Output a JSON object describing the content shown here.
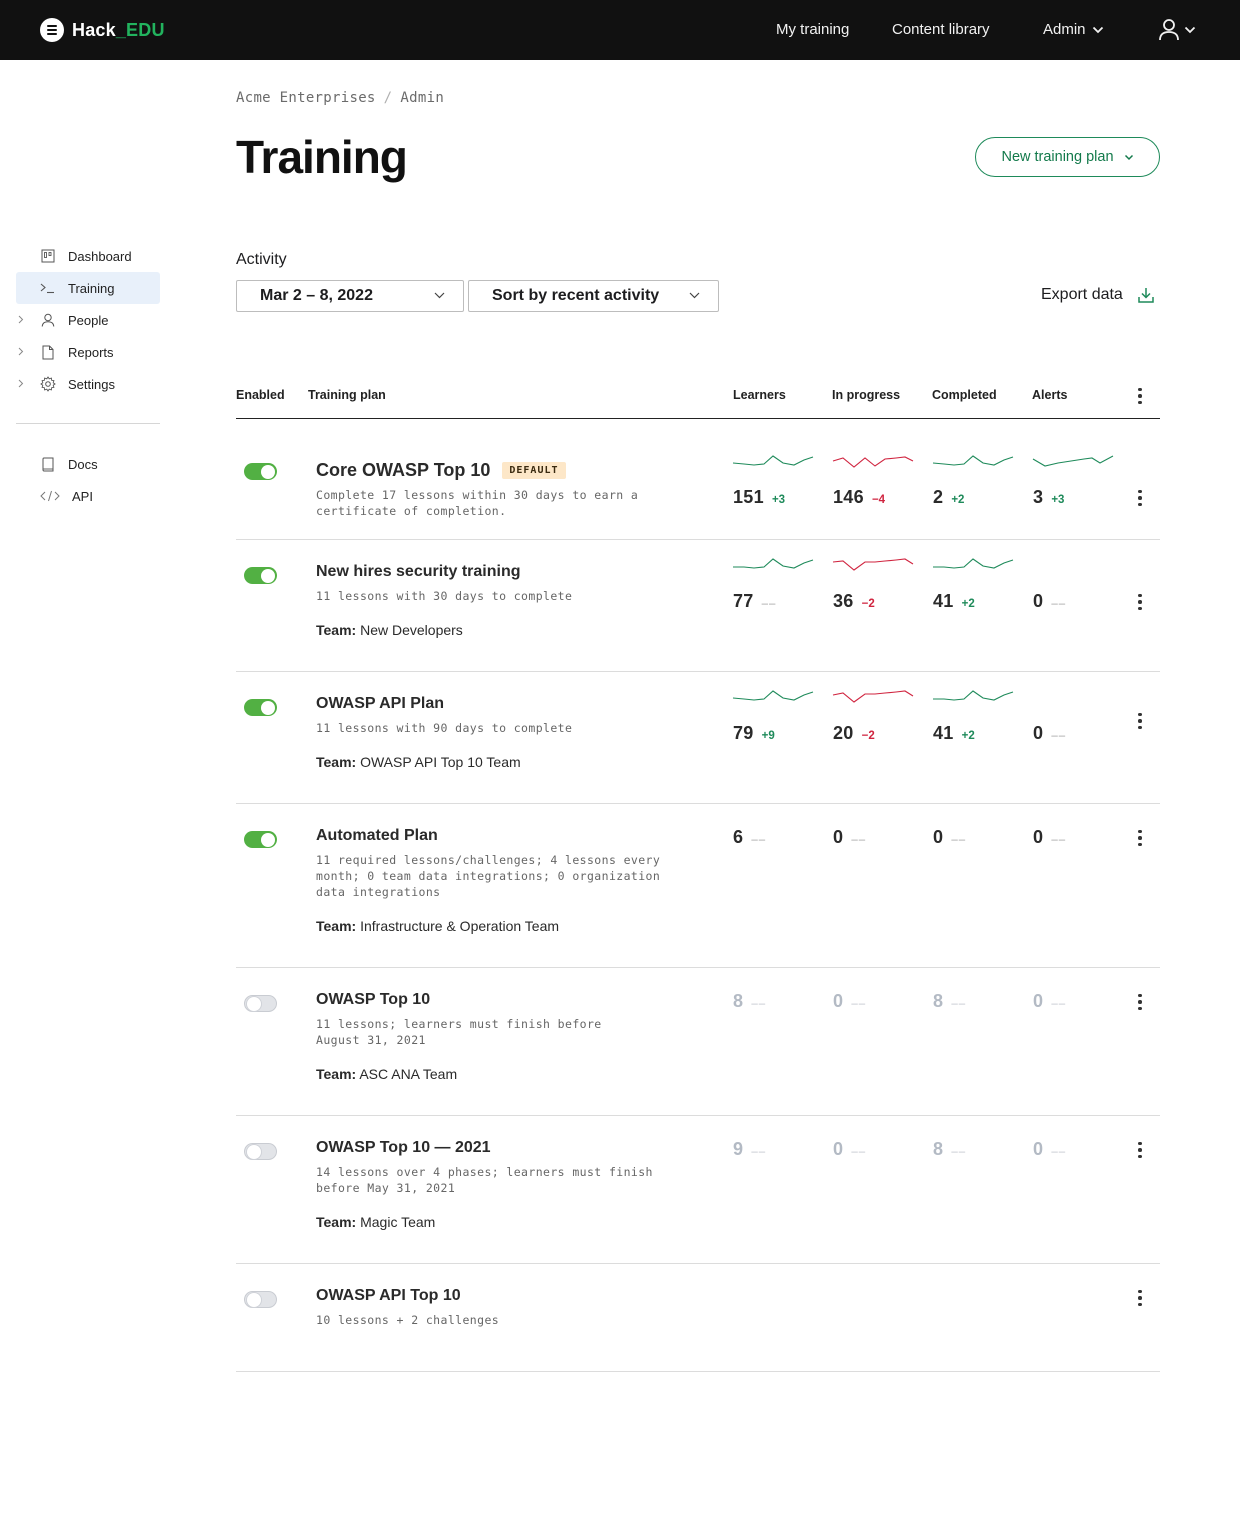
{
  "app": {
    "logo_prefix": "Hack",
    "logo_suffix": "_EDU"
  },
  "topnav": {
    "my_training": "My training",
    "content_library": "Content library",
    "admin": "Admin"
  },
  "sidebar": {
    "items": [
      {
        "label": "Dashboard",
        "icon": "dashboard-icon",
        "active": false,
        "expandable": false
      },
      {
        "label": "Training",
        "icon": "terminal-icon",
        "active": true,
        "expandable": false
      },
      {
        "label": "People",
        "icon": "person-icon",
        "active": false,
        "expandable": true
      },
      {
        "label": "Reports",
        "icon": "document-icon",
        "active": false,
        "expandable": true
      },
      {
        "label": "Settings",
        "icon": "gear-icon",
        "active": false,
        "expandable": true
      }
    ],
    "secondary": [
      {
        "label": "Docs",
        "icon": "book-icon"
      },
      {
        "label": "API",
        "icon": "code-icon"
      }
    ]
  },
  "breadcrumb": [
    "Acme Enterprises",
    "Admin"
  ],
  "page": {
    "title": "Training",
    "new_plan_label": "New training plan"
  },
  "activity": {
    "label": "Activity",
    "date_range": "Mar 2 – 8, 2022",
    "sort": "Sort by recent activity",
    "export_label": "Export data"
  },
  "table": {
    "headers": {
      "enabled": "Enabled",
      "plan": "Training plan",
      "learners": "Learners",
      "in_progress": "In progress",
      "completed": "Completed",
      "alerts": "Alerts"
    },
    "rows": [
      {
        "name": "Core OWASP Top 10",
        "badge": "DEFAULT",
        "desc": "Complete 17 lessons within 30 days to earn a certificate of completion.",
        "team_label": "",
        "team": "",
        "enabled": true,
        "metrics": {
          "learners": {
            "value": "151",
            "delta": "+3"
          },
          "in_progress": {
            "value": "146",
            "delta": "−4"
          },
          "completed": {
            "value": "2",
            "delta": "+2"
          },
          "alerts": {
            "value": "3",
            "delta": "+3"
          }
        }
      },
      {
        "name": "New hires security training",
        "badge": "",
        "desc": "11 lessons with 30 days to complete",
        "team_label": "Team:",
        "team": "New Developers",
        "enabled": true,
        "metrics": {
          "learners": {
            "value": "77",
            "delta": "––"
          },
          "in_progress": {
            "value": "36",
            "delta": "−2"
          },
          "completed": {
            "value": "41",
            "delta": "+2"
          },
          "alerts": {
            "value": "0",
            "delta": "––"
          }
        }
      },
      {
        "name": "OWASP API Plan",
        "badge": "",
        "desc": "11 lessons with 90 days to complete",
        "team_label": "Team:",
        "team": "OWASP API Top 10 Team",
        "enabled": true,
        "metrics": {
          "learners": {
            "value": "79",
            "delta": "+9"
          },
          "in_progress": {
            "value": "20",
            "delta": "−2"
          },
          "completed": {
            "value": "41",
            "delta": "+2"
          },
          "alerts": {
            "value": "0",
            "delta": "––"
          }
        }
      },
      {
        "name": "Automated Plan",
        "badge": "",
        "desc": "11 required lessons/challenges; 4 lessons every month; 0 team data integrations; 0 organization data integrations",
        "team_label": "Team:",
        "team": "Infrastructure & Operation Team",
        "enabled": true,
        "metrics": {
          "learners": {
            "value": "6",
            "delta": "––"
          },
          "in_progress": {
            "value": "0",
            "delta": "––"
          },
          "completed": {
            "value": "0",
            "delta": "––"
          },
          "alerts": {
            "value": "0",
            "delta": "––"
          }
        }
      },
      {
        "name": "OWASP Top 10",
        "badge": "",
        "desc": "11 lessons; learners must finish before August 31, 2021",
        "team_label": "Team:",
        "team": "ASC ANA Team",
        "enabled": false,
        "metrics": {
          "learners": {
            "value": "8",
            "delta": "––"
          },
          "in_progress": {
            "value": "0",
            "delta": "––"
          },
          "completed": {
            "value": "8",
            "delta": "––"
          },
          "alerts": {
            "value": "0",
            "delta": "––"
          }
        }
      },
      {
        "name": "OWASP Top 10 — 2021",
        "badge": "",
        "desc": "14 lessons over 4 phases; learners must finish before May 31, 2021",
        "team_label": "Team:",
        "team": "Magic Team",
        "enabled": false,
        "metrics": {
          "learners": {
            "value": "9",
            "delta": "––"
          },
          "in_progress": {
            "value": "0",
            "delta": "––"
          },
          "completed": {
            "value": "8",
            "delta": "––"
          },
          "alerts": {
            "value": "0",
            "delta": "––"
          }
        }
      },
      {
        "name": "OWASP API Top 10",
        "badge": "",
        "desc": "10 lessons + 2 challenges",
        "team_label": "",
        "team": "",
        "enabled": false,
        "metrics": null
      }
    ]
  },
  "colors": {
    "topbar": "#111111",
    "brand_green": "#22b35e",
    "toggle_on": "#52b043",
    "positive": "#1e8a5a",
    "negative": "#d0243f",
    "active_nav": "#e8f0fa",
    "badge_bg": "#fde7c8"
  }
}
